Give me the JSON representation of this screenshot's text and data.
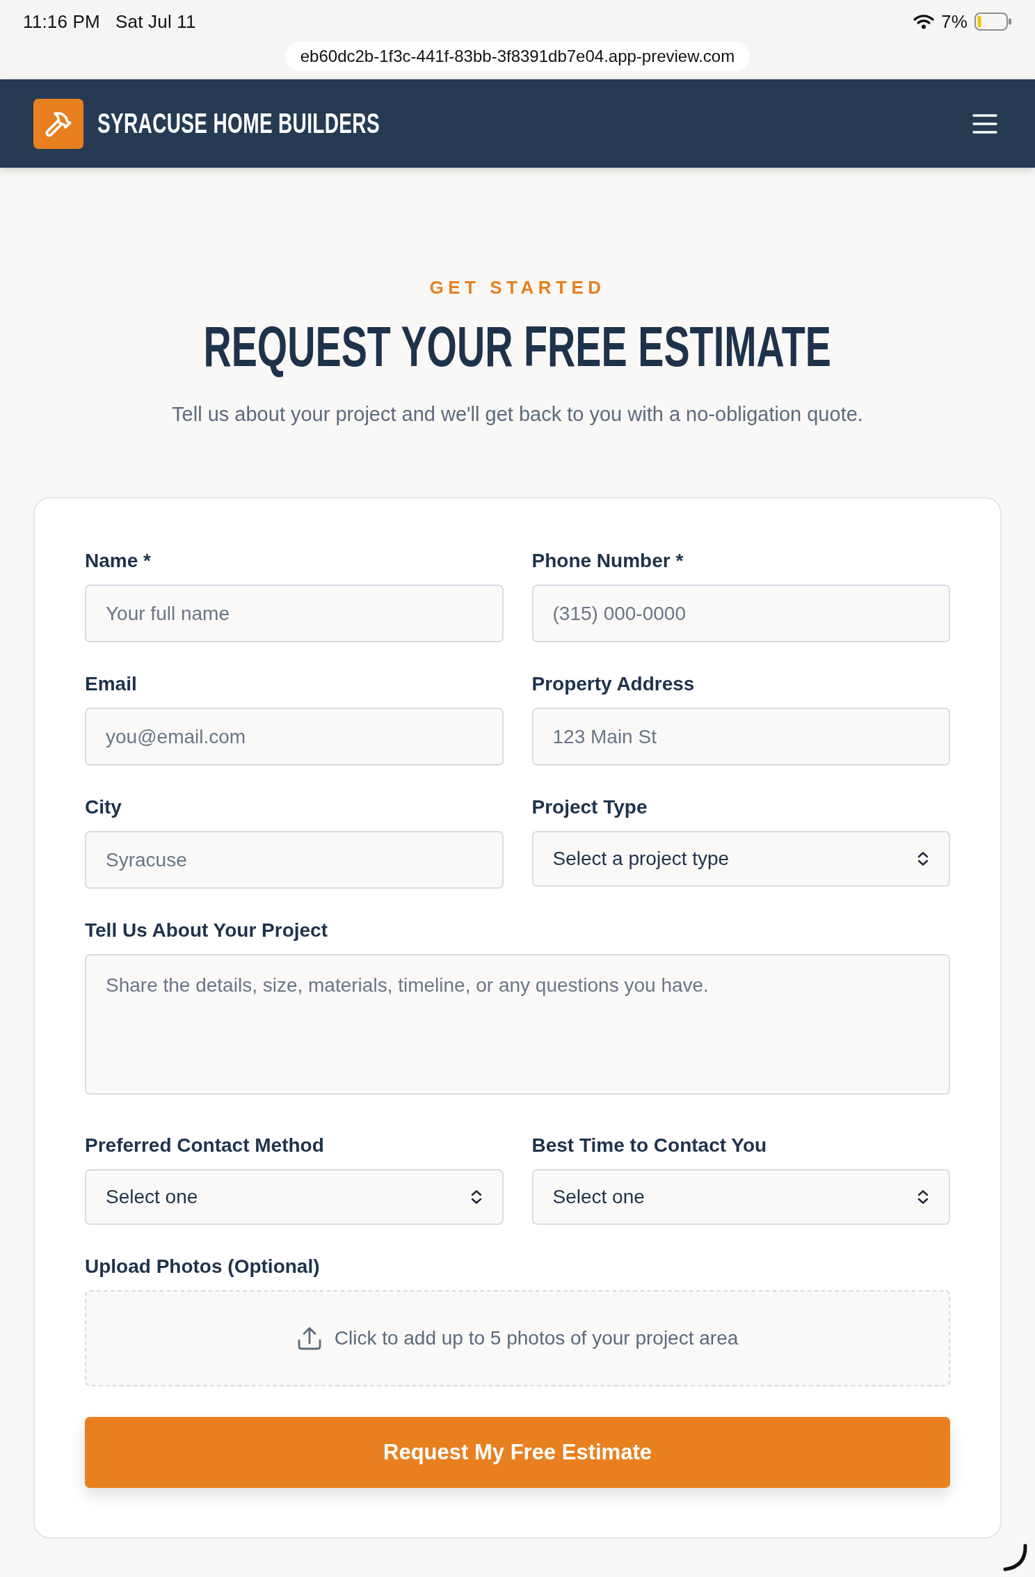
{
  "status_bar": {
    "time": "11:16 PM",
    "date": "Sat Jul 11",
    "battery": "7%"
  },
  "address_bar": {
    "url": "eb60dc2b-1f3c-441f-83bb-3f8391db7e04.app-preview.com"
  },
  "header": {
    "brand": "SYRACUSE HOME BUILDERS"
  },
  "intro": {
    "eyebrow": "GET STARTED",
    "title": "REQUEST YOUR FREE ESTIMATE",
    "subtitle": "Tell us about your project and we'll get back to you with a no-obligation quote."
  },
  "form": {
    "fields": [
      {
        "kind": "input",
        "label": "Name *",
        "placeholder": "Your full name"
      },
      {
        "kind": "input",
        "label": "Phone Number *",
        "placeholder": "(315) 000-0000"
      },
      {
        "kind": "input",
        "label": "Email",
        "placeholder": "you@email.com"
      },
      {
        "kind": "input",
        "label": "Property Address",
        "placeholder": "123 Main St"
      },
      {
        "kind": "input",
        "label": "City",
        "placeholder": "Syracuse"
      },
      {
        "kind": "select",
        "label": "Project Type",
        "value": "Select a project type"
      },
      {
        "kind": "textarea",
        "label": "Tell Us About Your Project",
        "placeholder": "Share the details, size, materials, timeline, or any questions you have."
      },
      {
        "kind": "select",
        "label": "Preferred Contact Method",
        "value": "Select one"
      },
      {
        "kind": "select",
        "label": "Best Time to Contact You",
        "value": "Select one"
      },
      {
        "kind": "upload",
        "label": "Upload Photos (Optional)",
        "prompt": "Click to add up to 5 photos of your project area"
      }
    ],
    "submit": "Request My Free Estimate"
  }
}
